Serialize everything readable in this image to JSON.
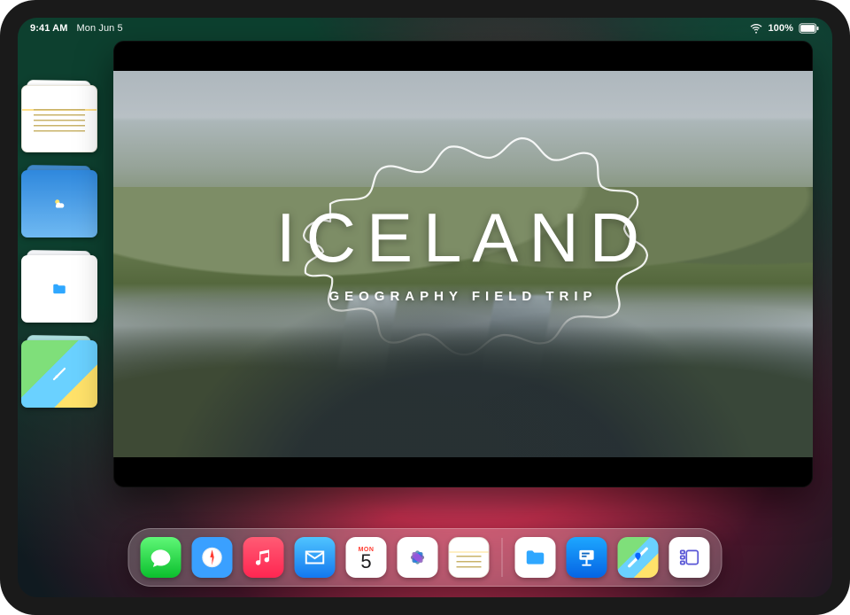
{
  "status": {
    "time": "9:41 AM",
    "date": "Mon Jun 5",
    "battery_pct": "100%"
  },
  "slide": {
    "title": "ICELAND",
    "subtitle": "GEOGRAPHY FIELD TRIP"
  },
  "calendar": {
    "dow": "MON",
    "day": "5"
  },
  "stage_items": [
    {
      "app": "Notes",
      "icon": "notes-icon"
    },
    {
      "app": "Weather",
      "icon": "weather-icon"
    },
    {
      "app": "Files",
      "icon": "files-icon"
    },
    {
      "app": "Maps",
      "icon": "maps-icon"
    }
  ],
  "dock_apps": [
    "Messages",
    "Safari",
    "Music",
    "Mail",
    "Calendar",
    "Photos",
    "Notes",
    "Files",
    "Keynote",
    "Maps",
    "Stage Manager"
  ]
}
